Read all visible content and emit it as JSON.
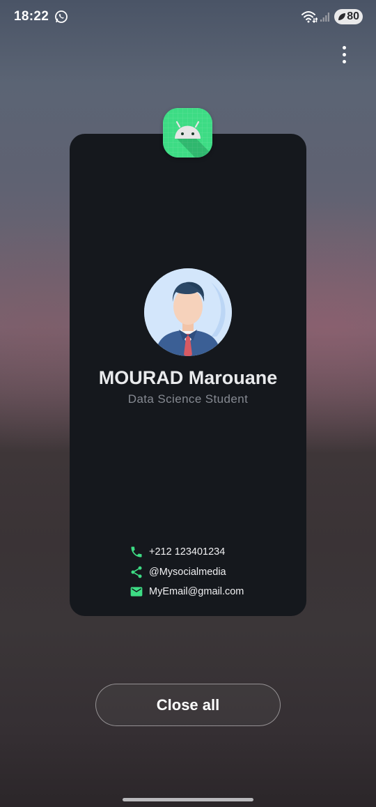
{
  "status_bar": {
    "time": "18:22",
    "notification_icons": [
      "whatsapp-icon"
    ],
    "system_icons": [
      "wifi-icon",
      "signal-icon"
    ],
    "battery_level": "80"
  },
  "recents": {
    "menu_icon": "more-vertical-icon",
    "app": {
      "icon": "android-icon",
      "preview": {
        "name": "MOURAD Marouane",
        "title": "Data Science Student",
        "contacts": [
          {
            "icon": "phone-icon",
            "text": "+212 123401234"
          },
          {
            "icon": "share-icon",
            "text": "@Mysocialmedia"
          },
          {
            "icon": "email-icon",
            "text": "MyEmail@gmail.com"
          }
        ]
      }
    },
    "close_all_label": "Close all"
  },
  "colors": {
    "card_background": "#15181d",
    "accent_green": "#3ddc84",
    "name_text": "#e9eaec",
    "subtitle_text": "#868a92"
  }
}
